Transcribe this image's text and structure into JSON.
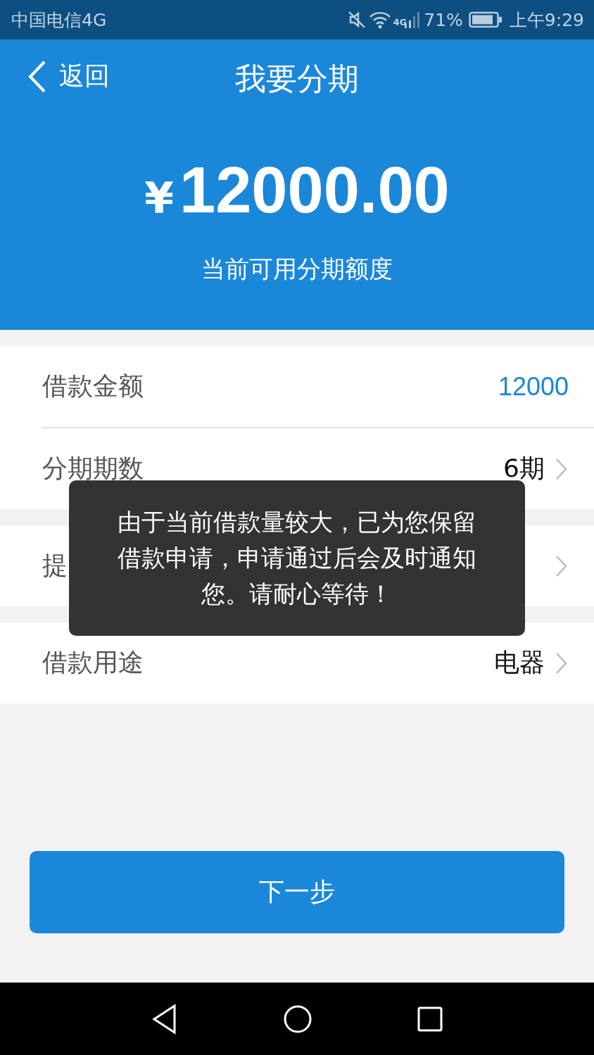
{
  "status_bar": {
    "carrier": "中国电信4G",
    "network": "4G",
    "battery": "71%",
    "time": "上午9:29"
  },
  "nav": {
    "back": "返回",
    "title": "我要分期"
  },
  "credit": {
    "currency": "¥",
    "amount": "12000.00",
    "caption": "当前可用分期额度"
  },
  "sections": [
    {
      "rows": [
        {
          "label": "借款金额",
          "value": "12000",
          "kind": "amount"
        },
        {
          "label": "分期期数",
          "value": "6期",
          "kind": "select"
        }
      ]
    },
    {
      "rows": [
        {
          "label": "提",
          "kind": "select"
        }
      ]
    },
    {
      "rows": [
        {
          "label": "借款用途",
          "value": "电器",
          "kind": "select"
        }
      ]
    }
  ],
  "toast": {
    "message": "由于当前借款量较大，已为您保留借款申请，申请通过后会及时通知您。请耐心等待！"
  },
  "next_button": "下一步"
}
